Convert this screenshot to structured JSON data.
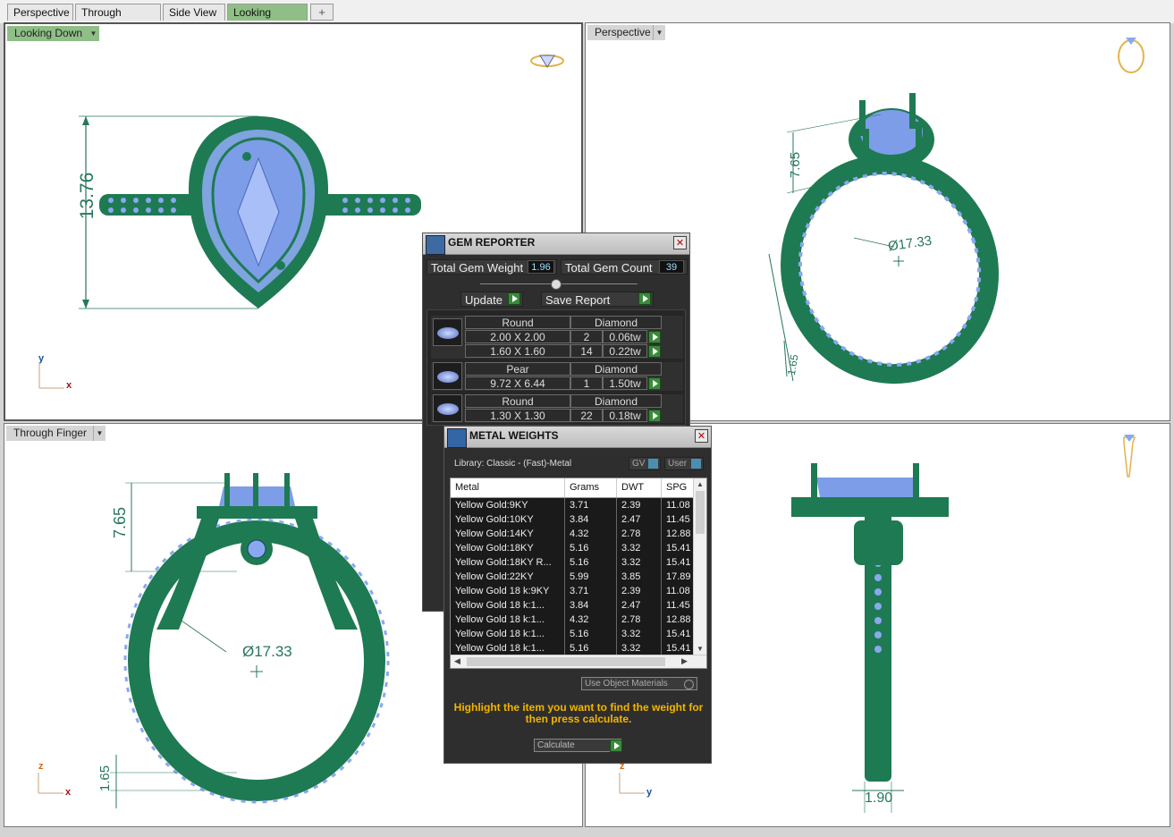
{
  "tabs": [
    {
      "label": "Perspective",
      "active": false
    },
    {
      "label": "Through Finger",
      "active": false
    },
    {
      "label": "Side View",
      "active": false
    },
    {
      "label": "Looking Down",
      "active": true
    }
  ],
  "viewports": {
    "top_left": {
      "label": "Looking Down",
      "dim_height": "13.76",
      "axis_v": "y",
      "axis_h": "x"
    },
    "top_right": {
      "label": "Perspective",
      "dim_a": "7.65",
      "dim_diam": "Ø17.33",
      "dim_b": "1.65"
    },
    "bottom_left": {
      "label": "Through Finger",
      "dim_top": "7.65",
      "dim_diam": "Ø17.33",
      "dim_bottom": "1.65",
      "axis_v": "z",
      "axis_h": "x"
    },
    "bottom_right": {
      "label": "",
      "dim_width": "1.90",
      "axis_v": "z",
      "axis_h": "y"
    }
  },
  "gem_reporter": {
    "title": "GEM REPORTER",
    "total_weight_label": "Total Gem Weight",
    "total_weight": "1.96",
    "total_count_label": "Total Gem Count",
    "total_count": "39",
    "update_label": "Update",
    "save_label": "Save Report",
    "groups": [
      {
        "shape": "Round",
        "material": "Diamond",
        "rows": [
          {
            "size": "2.00 X 2.00",
            "count": "2",
            "weight": "0.06tw"
          },
          {
            "size": "1.60 X 1.60",
            "count": "14",
            "weight": "0.22tw"
          }
        ]
      },
      {
        "shape": "Pear",
        "material": "Diamond",
        "rows": [
          {
            "size": "9.72 X 6.44",
            "count": "1",
            "weight": "1.50tw"
          }
        ]
      },
      {
        "shape": "Round",
        "material": "Diamond",
        "rows": [
          {
            "size": "1.30 X 1.30",
            "count": "22",
            "weight": "0.18tw"
          }
        ]
      }
    ]
  },
  "metal_weights": {
    "title": "METAL WEIGHTS",
    "library": "Library: Classic - (Fast)-Metal",
    "gv_label": "GV",
    "user_label": "User",
    "columns": [
      "Metal",
      "Grams",
      "DWT",
      "SPG"
    ],
    "rows": [
      [
        "Yellow Gold:9KY",
        "3.71",
        "2.39",
        "11.08"
      ],
      [
        "Yellow Gold:10KY",
        "3.84",
        "2.47",
        "11.45"
      ],
      [
        "Yellow Gold:14KY",
        "4.32",
        "2.78",
        "12.88"
      ],
      [
        "Yellow Gold:18KY",
        "5.16",
        "3.32",
        "15.41"
      ],
      [
        "Yellow Gold:18KY R...",
        "5.16",
        "3.32",
        "15.41"
      ],
      [
        "Yellow Gold:22KY",
        "5.99",
        "3.85",
        "17.89"
      ],
      [
        "Yellow Gold 18 k:9KY",
        "3.71",
        "2.39",
        "11.08"
      ],
      [
        "Yellow Gold 18 k:1...",
        "3.84",
        "2.47",
        "11.45"
      ],
      [
        "Yellow Gold 18 k:1...",
        "4.32",
        "2.78",
        "12.88"
      ],
      [
        "Yellow Gold 18 k:1...",
        "5.16",
        "3.32",
        "15.41"
      ],
      [
        "Yellow Gold 18 k:1...",
        "5.16",
        "3.32",
        "15.41"
      ]
    ],
    "use_object_materials": "Use Object Materials",
    "hint": "Highlight the item you want to find the weight for then press calculate.",
    "calculate_label": "Calculate"
  },
  "colors": {
    "metal": "#1e7a52",
    "gem": "#8aa8f0",
    "active_tab": "#8fbf86"
  }
}
